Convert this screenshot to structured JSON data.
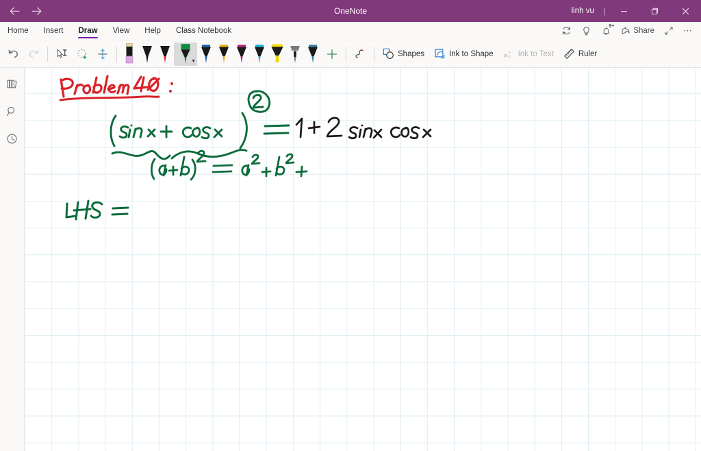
{
  "titlebar": {
    "back_icon": "arrow-left-icon",
    "forward_icon": "arrow-right-icon",
    "app_title": "OneNote",
    "user": "linh vu",
    "separator": "|",
    "minimize": "─",
    "maximize": "□",
    "close": "✕",
    "bg_color": "#80397B"
  },
  "menubar": {
    "tabs": [
      {
        "label": "Home",
        "active": false
      },
      {
        "label": "Insert",
        "active": false
      },
      {
        "label": "Draw",
        "active": true
      },
      {
        "label": "View",
        "active": false
      },
      {
        "label": "Help",
        "active": false
      },
      {
        "label": "Class Notebook",
        "active": false
      }
    ],
    "active_tab_underline_color": "#7719aa",
    "right_actions": [
      {
        "name": "sync-icon",
        "label": ""
      },
      {
        "name": "lightbulb-icon",
        "label": ""
      },
      {
        "name": "notifications-bell-icon",
        "label": "",
        "badge": "9+"
      },
      {
        "name": "share-button",
        "label": "Share"
      },
      {
        "name": "expand-icon",
        "label": ""
      },
      {
        "name": "more-options-icon",
        "label": "⋯"
      }
    ]
  },
  "ribbon": {
    "undo_label": "Undo",
    "redo_label": "Redo",
    "undo_enabled": true,
    "redo_enabled": false,
    "tools": [
      {
        "name": "select-type-tool",
        "label": "Type"
      },
      {
        "name": "lasso-select-tool",
        "label": "Lasso Select"
      },
      {
        "name": "insert-space-tool",
        "label": "Insert Space"
      }
    ],
    "pens": [
      {
        "name": "eraser",
        "type": "eraser",
        "color": "#d9a9df",
        "cap": "#e8d6a8",
        "selected": false
      },
      {
        "name": "pen-black",
        "type": "pen",
        "color": "#1a1a1a",
        "selected": false
      },
      {
        "name": "pen-red",
        "type": "pen",
        "color": "#d8232a",
        "selected": false
      },
      {
        "name": "pen-green",
        "type": "pen",
        "color": "#0d8a3e",
        "selected": true
      },
      {
        "name": "pen-blue",
        "type": "pen",
        "color": "#1b5fa8",
        "selected": false
      },
      {
        "name": "pen-yellow",
        "type": "pen",
        "color": "#e8a800",
        "selected": false
      },
      {
        "name": "pen-magenta",
        "type": "pen",
        "color": "#b4207f",
        "selected": false
      },
      {
        "name": "pen-cyan",
        "type": "pen",
        "color": "#19a8d8",
        "selected": false
      },
      {
        "name": "highlighter-yellow",
        "type": "highlighter",
        "color": "#f5d800",
        "selected": false
      },
      {
        "name": "pencil-gray",
        "type": "pencil",
        "color": "#7a7a7a",
        "selected": false
      },
      {
        "name": "pen-teal",
        "type": "pen",
        "color": "#2f7f9e",
        "selected": false
      }
    ],
    "add_pen_label": "+",
    "ink_color_thickness_label": "Ink Color & Thickness",
    "buttons": [
      {
        "name": "shapes-button",
        "label": "Shapes",
        "disabled": false
      },
      {
        "name": "ink-to-shape-button",
        "label": "Ink to Shape",
        "disabled": false
      },
      {
        "name": "ink-to-text-button",
        "label": "Ink to Text",
        "disabled": true
      },
      {
        "name": "ruler-button",
        "label": "Ruler",
        "disabled": false
      }
    ]
  },
  "sidebar": {
    "items": [
      {
        "name": "notebooks-icon",
        "label": "Notebooks"
      },
      {
        "name": "search-icon",
        "label": "Search"
      },
      {
        "name": "recent-notes-icon",
        "label": "Recent Notes"
      }
    ]
  },
  "canvas": {
    "grid_color": "#d9ecf2",
    "grid_size_px": 39,
    "ink_notes": [
      {
        "name": "problem-heading",
        "text": "Problem 40 :",
        "color": "#d8232a",
        "underlined": true
      },
      {
        "name": "equation-lhs",
        "text": "(sin x + cos x)² =",
        "color": "#0b6b3a"
      },
      {
        "name": "equation-rhs",
        "text": "1 + 2 sinx cosx",
        "color": "#1a1a1a"
      },
      {
        "name": "expansion-formula",
        "text": "(a+b)² = a² + b² +",
        "color": "#0b6b3a"
      },
      {
        "name": "lhs-label",
        "text": "LHS =",
        "color": "#0b6b3a"
      },
      {
        "name": "exponent-circle",
        "text": "2",
        "color": "#0b6b3a"
      }
    ]
  }
}
